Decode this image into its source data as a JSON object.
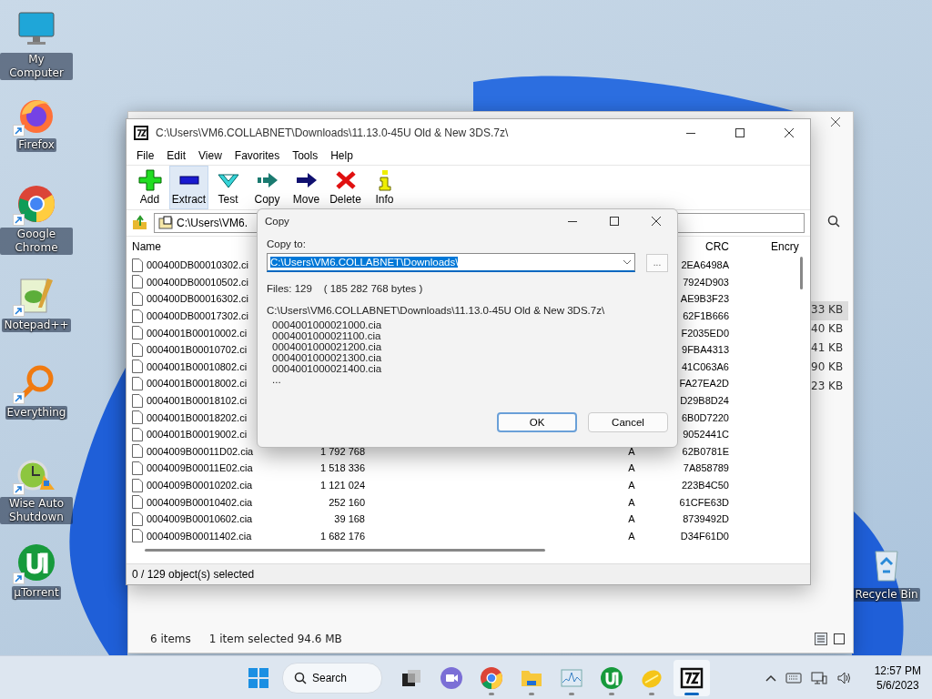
{
  "desktop_icons": [
    {
      "kind": "computer",
      "label": "My Computer",
      "shortcut": false
    },
    {
      "kind": "firefox",
      "label": "Firefox",
      "shortcut": true
    },
    {
      "kind": "chrome",
      "label": "Google Chrome",
      "shortcut": true
    },
    {
      "kind": "notepad",
      "label": "Notepad++",
      "shortcut": true
    },
    {
      "kind": "everything",
      "label": "Everything",
      "shortcut": true
    },
    {
      "kind": "clock",
      "label": "Wise Auto Shutdown",
      "shortcut": true
    },
    {
      "kind": "utorrent",
      "label": "µTorrent",
      "shortcut": true
    }
  ],
  "recycle_bin": {
    "label": "Recycle Bin"
  },
  "background_window": {
    "sizes": [
      {
        "text": "33 KB",
        "selected": true
      },
      {
        "text": "40 KB",
        "selected": false
      },
      {
        "text": "41 KB",
        "selected": false
      },
      {
        "text": "90 KB",
        "selected": false
      },
      {
        "text": "23 KB",
        "selected": false
      }
    ],
    "status": {
      "items": "6 items",
      "selection": "1 item selected  94.6 MB"
    }
  },
  "archive_window": {
    "title": "C:\\Users\\VM6.COLLABNET\\Downloads\\11.13.0-45U Old & New 3DS.7z\\",
    "menu": [
      "File",
      "Edit",
      "View",
      "Favorites",
      "Tools",
      "Help"
    ],
    "toolbar": [
      {
        "kind": "add",
        "label": "Add",
        "hovered": false
      },
      {
        "kind": "extract",
        "label": "Extract",
        "hovered": true
      },
      {
        "kind": "test",
        "label": "Test",
        "hovered": false
      },
      {
        "kind": "copy",
        "label": "Copy",
        "hovered": false
      },
      {
        "kind": "move",
        "label": "Move",
        "hovered": false
      },
      {
        "kind": "delete",
        "label": "Delete",
        "hovered": false
      },
      {
        "kind": "info",
        "label": "Info",
        "hovered": false
      }
    ],
    "address": "C:\\Users\\VM6.",
    "columns": {
      "name": "Name",
      "crc": "CRC",
      "column_8": "Encry"
    },
    "rows": [
      {
        "name": "000400DB00010302.ci",
        "crc": "2EA6498A"
      },
      {
        "name": "000400DB00010502.ci",
        "crc": "7924D903"
      },
      {
        "name": "000400DB00016302.ci",
        "crc": "AE9B3F23"
      },
      {
        "name": "000400DB00017302.ci",
        "crc": "62F1B666"
      },
      {
        "name": "0004001B00010002.ci",
        "crc": "F2035ED0"
      },
      {
        "name": "0004001B00010702.ci",
        "crc": "9FBA4313"
      },
      {
        "name": "0004001B00010802.ci",
        "crc": "41C063A6"
      },
      {
        "name": "0004001B00018002.ci",
        "crc": "FA27EA2D"
      },
      {
        "name": "0004001B00018102.ci",
        "crc": "D29B8D24"
      },
      {
        "name": "0004001B00018202.ci",
        "crc": "6B0D7220"
      },
      {
        "name": "0004001B00019002.ci",
        "crc": "9052441C"
      },
      {
        "name": "0004009B00011D02.cia",
        "size": "1 792 768",
        "attributes": "A",
        "crc": "62B0781E"
      },
      {
        "name": "0004009B00011E02.cia",
        "size": "1 518 336",
        "attributes": "A",
        "crc": "7A858789"
      },
      {
        "name": "0004009B00010202.cia",
        "size": "1 121 024",
        "attributes": "A",
        "crc": "223B4C50"
      },
      {
        "name": "0004009B00010402.cia",
        "size": "252 160",
        "attributes": "A",
        "crc": "61CFE63D"
      },
      {
        "name": "0004009B00010602.cia",
        "size": "39 168",
        "attributes": "A",
        "crc": "8739492D"
      },
      {
        "name": "0004009B00011402.cia",
        "size": "1 682 176",
        "attributes": "A",
        "crc": "D34F61D0"
      }
    ],
    "status": "0 / 129 object(s) selected"
  },
  "copy_dialog": {
    "title": "Copy",
    "copy_to_label": "Copy to:",
    "destination": "C:\\Users\\VM6.COLLABNET\\Downloads\\",
    "browse": "...",
    "files_info": "Files: 129    ( 185 282 768 bytes )",
    "source_path": "C:\\Users\\VM6.COLLABNET\\Downloads\\11.13.0-45U Old & New 3DS.7z\\",
    "files": [
      "0004001000021000.cia",
      "0004001000021100.cia",
      "0004001000021200.cia",
      "0004001000021300.cia",
      "0004001000021400.cia",
      "..."
    ],
    "buttons": [
      {
        "label": "OK",
        "default": true
      },
      {
        "label": "Cancel",
        "default": false
      }
    ]
  },
  "taskbar": {
    "search": "Search",
    "apps": [
      {
        "kind": "taskview",
        "running": false,
        "selected": false
      },
      {
        "kind": "meet",
        "running": false,
        "selected": false
      },
      {
        "kind": "chrome",
        "running": true,
        "selected": false
      },
      {
        "kind": "folder",
        "running": true,
        "selected": false
      },
      {
        "kind": "monitor",
        "running": true,
        "selected": false
      },
      {
        "kind": "utorrent",
        "running": true,
        "selected": false
      },
      {
        "kind": "lemon",
        "running": true,
        "selected": false
      },
      {
        "kind": "sevenzip",
        "running": true,
        "selected": true
      }
    ],
    "time": "12:57 PM",
    "date": "5/6/2023"
  }
}
